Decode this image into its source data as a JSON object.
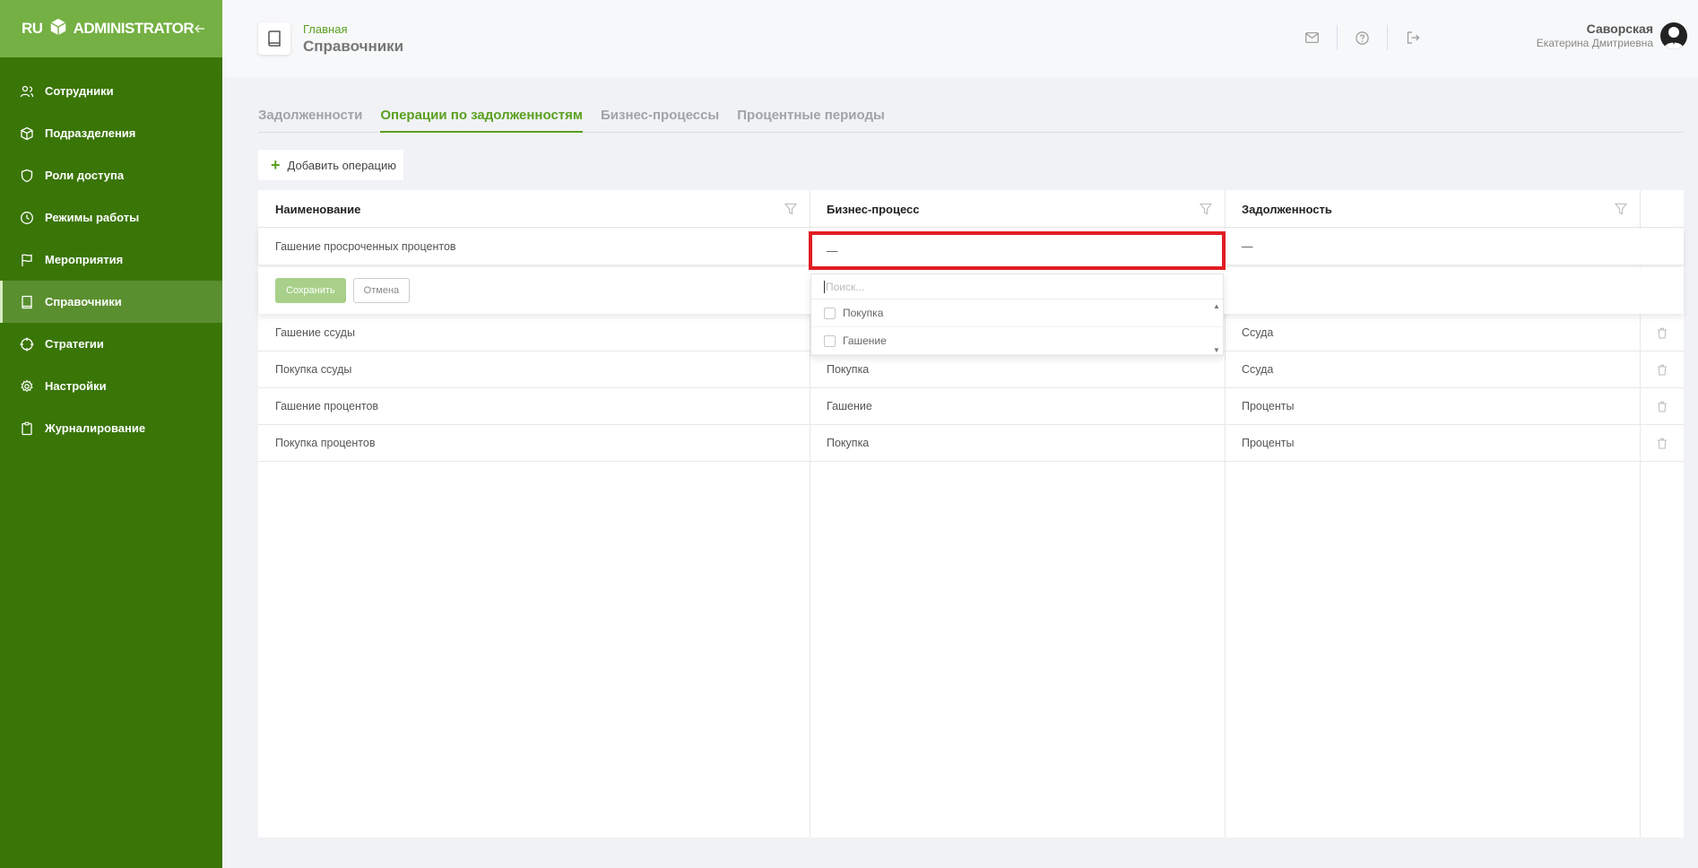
{
  "sidebar": {
    "logo": {
      "left": "RU",
      "right": "ADMINISTRATOR"
    },
    "items": [
      {
        "label": "Сотрудники",
        "icon": "users-icon"
      },
      {
        "label": "Подразделения",
        "icon": "cube-icon"
      },
      {
        "label": "Роли доступа",
        "icon": "shield-icon"
      },
      {
        "label": "Режимы работы",
        "icon": "clock-icon"
      },
      {
        "label": "Мероприятия",
        "icon": "flag-icon"
      },
      {
        "label": "Справочники",
        "icon": "book-icon",
        "active": true
      },
      {
        "label": "Стратегии",
        "icon": "crosshair-icon"
      },
      {
        "label": "Настройки",
        "icon": "gear-icon"
      },
      {
        "label": "Журналирование",
        "icon": "clipboard-icon"
      }
    ]
  },
  "header": {
    "breadcrumb_home": "Главная",
    "title": "Справочники",
    "user": {
      "last_name": "Саворская",
      "first_name": "Екатерина Дмитриевна"
    }
  },
  "tabs": [
    {
      "label": "Задолженности",
      "active": false
    },
    {
      "label": "Операции по задолженностям",
      "active": true
    },
    {
      "label": "Бизнес-процессы",
      "active": false
    },
    {
      "label": "Процентные периоды",
      "active": false
    }
  ],
  "add_button": "Добавить операцию",
  "table": {
    "columns": [
      "Наименование",
      "Бизнес-процесс",
      "Задолженность"
    ],
    "edit_row": {
      "name": "Гашение просроченных процентов",
      "process": "—",
      "debt": "—"
    },
    "save_label": "Сохранить",
    "cancel_label": "Отмена",
    "rows": [
      {
        "name": "Гашение ссуды",
        "process": "",
        "debt": "Ссуда"
      },
      {
        "name": "Покупка ссуды",
        "process": "Покупка",
        "debt": "Ссуда"
      },
      {
        "name": "Гашение процентов",
        "process": "Гашение",
        "debt": "Проценты"
      },
      {
        "name": "Покупка процентов",
        "process": "Покупка",
        "debt": "Проценты"
      }
    ]
  },
  "dropdown": {
    "search_placeholder": "Поиск...",
    "options": [
      "Покупка",
      "Гашение"
    ]
  },
  "colors": {
    "sidebar": "#3a7508",
    "sidebar_header": "#74b043",
    "accent": "#5aa020",
    "highlight": "#e11d24"
  }
}
